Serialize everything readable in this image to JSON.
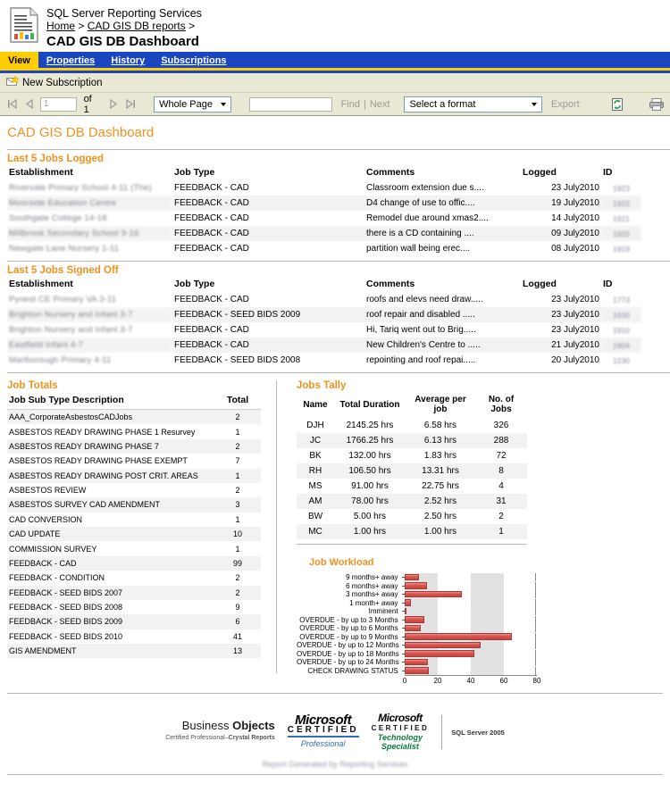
{
  "header": {
    "app_title": "SQL Server Reporting Services",
    "breadcrumb": {
      "home": "Home",
      "sep1": ">",
      "parent": "CAD GIS DB reports",
      "sep2": ">"
    },
    "report_title": "CAD GIS DB Dashboard",
    "icon": "report-document-icon"
  },
  "tabs": [
    {
      "label": "View",
      "active": true
    },
    {
      "label": "Properties",
      "active": false
    },
    {
      "label": "History",
      "active": false
    },
    {
      "label": "Subscriptions",
      "active": false
    }
  ],
  "subscription_bar": {
    "icon": "new-subscription-icon",
    "label": "New Subscription"
  },
  "toolbar": {
    "first_page_icon": "first-page-icon",
    "prev_page_icon": "previous-page-icon",
    "page_value": "1",
    "of_label": "of 1",
    "next_page_icon": "next-page-icon",
    "last_page_icon": "last-page-icon",
    "zoom_value": "Whole Page",
    "find_value": "",
    "find_label": "Find",
    "find_sep": "|",
    "next_label": "Next",
    "format_value": "Select a format",
    "export_label": "Export",
    "refresh_icon": "refresh-icon",
    "print_icon": "print-icon"
  },
  "report": {
    "title": "CAD GIS DB Dashboard",
    "accent_color": "#f0911e",
    "jobs_logged": {
      "heading": "Last 5 Jobs Logged",
      "columns": [
        "Establishment",
        "Job Type",
        "Comments",
        "Logged",
        "ID"
      ],
      "rows": [
        {
          "establishment": "Rivervale Primary School 4-11 (The)",
          "job_type": "FEEDBACK - CAD",
          "comments": "Classroom extension due s....",
          "logged": "23 July2010",
          "id": "1923"
        },
        {
          "establishment": "Moorside Education Centre",
          "job_type": "FEEDBACK - CAD",
          "comments": "D4 change of use to offic....",
          "logged": "19 July2010",
          "id": "1922"
        },
        {
          "establishment": "Southgate College 14-18",
          "job_type": "FEEDBACK - CAD",
          "comments": "Remodel due around xmas2....",
          "logged": "14 July2010",
          "id": "1921"
        },
        {
          "establishment": "Millbrook Secondary School 9-16",
          "job_type": "FEEDBACK - CAD",
          "comments": "there is a CD containing ....",
          "logged": "09 July2010",
          "id": "1920"
        },
        {
          "establishment": "Newgate Lane Nursery 1-11",
          "job_type": "FEEDBACK - CAD",
          "comments": "partition wall being erec....",
          "logged": "08 July2010",
          "id": "1919"
        }
      ]
    },
    "jobs_signed_off": {
      "heading": "Last 5 Jobs Signed Off",
      "columns": [
        "Establishment",
        "Job Type",
        "Comments",
        "Logged",
        "ID"
      ],
      "rows": [
        {
          "establishment": "Pynest CE Primary VA 3-11",
          "job_type": "FEEDBACK - CAD",
          "comments": "roofs and elevs need draw.....",
          "logged": "23 July2010",
          "id": "1773"
        },
        {
          "establishment": "Brighton Nursery and Infant 3-7",
          "job_type": "FEEDBACK - SEED BIDS 2009",
          "comments": "roof repair and disabled .....",
          "logged": "23 July2010",
          "id": "1630"
        },
        {
          "establishment": "Brighton Nursery and Infant 3-7",
          "job_type": "FEEDBACK - CAD",
          "comments": "Hi, Tariq went out to Brig.....",
          "logged": "23 July2010",
          "id": "1910"
        },
        {
          "establishment": "Eastfield Infant 4-7",
          "job_type": "FEEDBACK - CAD",
          "comments": "New Children's Centre to .....",
          "logged": "21 July2010",
          "id": "1804"
        },
        {
          "establishment": "Marlborough Primary 4-11",
          "job_type": "FEEDBACK - SEED BIDS 2008",
          "comments": "repointing and roof repai.....",
          "logged": "20 July2010",
          "id": "1230"
        }
      ]
    },
    "job_totals": {
      "heading": "Job Totals",
      "columns": [
        "Job Sub Type Description",
        "Total"
      ],
      "rows": [
        {
          "description": "AAA_CorporateAsbestosCADJobs",
          "total": "2"
        },
        {
          "description": "ASBESTOS READY DRAWING PHASE 1 Resurvey",
          "total": "1"
        },
        {
          "description": "ASBESTOS READY DRAWING PHASE 7",
          "total": "2"
        },
        {
          "description": "ASBESTOS READY DRAWING PHASE EXEMPT",
          "total": "7"
        },
        {
          "description": "ASBESTOS READY DRAWING POST CRIT. AREAS",
          "total": "1"
        },
        {
          "description": "ASBESTOS REVIEW",
          "total": "2"
        },
        {
          "description": "ASBESTOS SURVEY CAD AMENDMENT",
          "total": "3"
        },
        {
          "description": "CAD CONVERSION",
          "total": "1"
        },
        {
          "description": "CAD UPDATE",
          "total": "10"
        },
        {
          "description": "COMMISSION SURVEY",
          "total": "1"
        },
        {
          "description": "FEEDBACK - CAD",
          "total": "99"
        },
        {
          "description": "FEEDBACK - CONDITION",
          "total": "2"
        },
        {
          "description": "FEEDBACK - SEED BIDS 2007",
          "total": "2"
        },
        {
          "description": "FEEDBACK - SEED BIDS 2008",
          "total": "9"
        },
        {
          "description": "FEEDBACK - SEED BIDS 2009",
          "total": "6"
        },
        {
          "description": "FEEDBACK - SEED BIDS 2010",
          "total": "41"
        },
        {
          "description": "GIS AMENDMENT",
          "total": "13"
        }
      ]
    },
    "jobs_tally": {
      "heading": "Jobs Tally",
      "columns": [
        "Name",
        "Total Duration",
        "Average per job",
        "No. of Jobs"
      ],
      "rows": [
        {
          "name": "DJH",
          "total_duration": "2145.25 hrs",
          "average": "6.58 hrs",
          "jobs": "326"
        },
        {
          "name": "JC",
          "total_duration": "1766.25 hrs",
          "average": "6.13 hrs",
          "jobs": "288"
        },
        {
          "name": "BK",
          "total_duration": "132.00 hrs",
          "average": "1.83 hrs",
          "jobs": "72"
        },
        {
          "name": "RH",
          "total_duration": "106.50 hrs",
          "average": "13.31 hrs",
          "jobs": "8"
        },
        {
          "name": "MS",
          "total_duration": "91.00 hrs",
          "average": "22.75 hrs",
          "jobs": "4"
        },
        {
          "name": "AM",
          "total_duration": "78.00 hrs",
          "average": "2.52 hrs",
          "jobs": "31"
        },
        {
          "name": "BW",
          "total_duration": "5.00 hrs",
          "average": "2.50 hrs",
          "jobs": "2"
        },
        {
          "name": "MC",
          "total_duration": "1.00 hrs",
          "average": "1.00 hrs",
          "jobs": "1"
        }
      ]
    }
  },
  "chart_data": {
    "type": "bar",
    "orientation": "horizontal",
    "title": "Job Workload",
    "xlabel": "",
    "ylabel": "",
    "xlim": [
      0,
      80
    ],
    "xticks": [
      0,
      20,
      40,
      60,
      80
    ],
    "grid": false,
    "legend": false,
    "bar_color": "#d9534f",
    "categories": [
      "9 months+ away",
      "6 months+ away",
      "3 months+ away",
      "1 month+ away",
      "Imminent",
      "OVERDUE - by up to 3 Months",
      "OVERDUE - by up to 6 Months",
      "OVERDUE - by up to 9 Months",
      "OVERDUE - by up to 12 Months",
      "OVERDUE - by up to 18 Months",
      "OVERDUE - by up to 24 Months",
      "CHECK DRAWING STATUS"
    ],
    "values": [
      9,
      14,
      35,
      4,
      1,
      12,
      10,
      65,
      46,
      42,
      14,
      15
    ]
  },
  "footer": {
    "business_objects": {
      "name_light": "Business ",
      "name_bold": "Objects",
      "sub_light": "Certified Professional",
      "sub_bold": "Crystal Reports"
    },
    "ms_certified_professional": {
      "word": "Microsoft",
      "cert": "CERTIFIED",
      "level": "Professional"
    },
    "ms_certified_tech": {
      "word": "Microsoft",
      "cert": "CERTIFIED",
      "line1": "Technology",
      "line2": "Specialist"
    },
    "sql_server": "SQL Server 2005",
    "blurred_note": "Report Generated by Reporting Services"
  }
}
